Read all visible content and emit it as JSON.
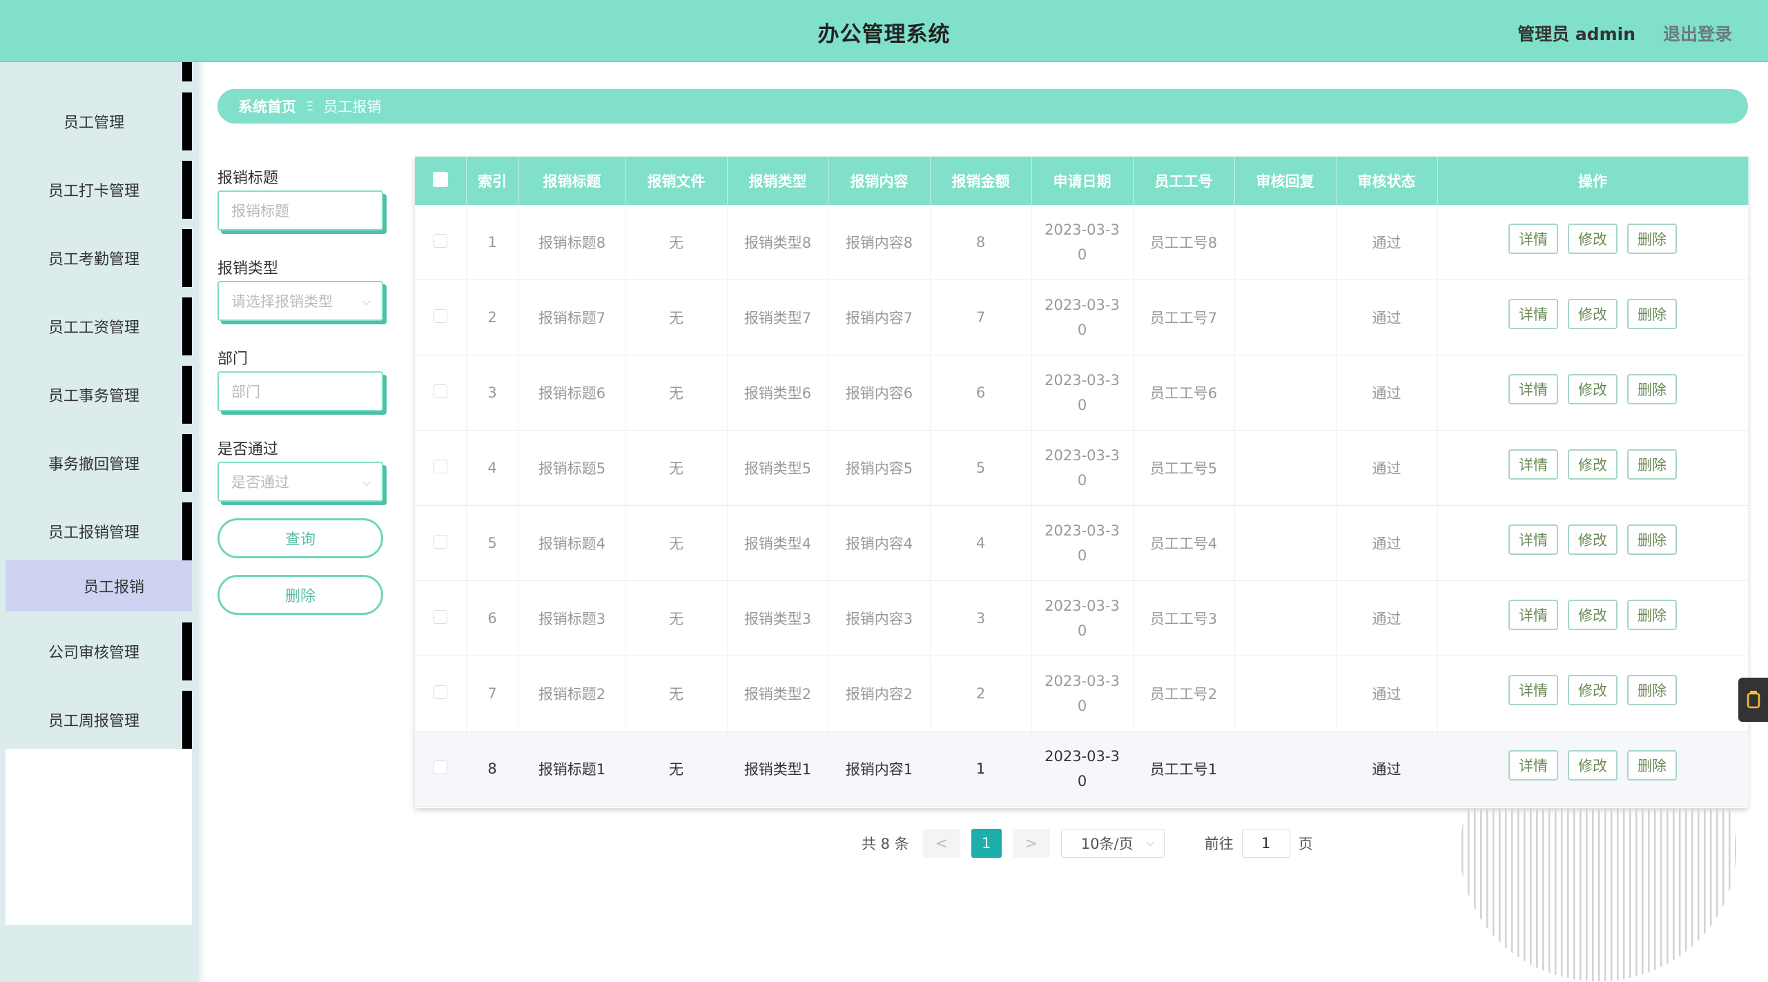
{
  "header": {
    "app_title": "办公管理系统",
    "user_label": "管理员 admin",
    "logout_label": "退出登录"
  },
  "sidebar": {
    "items": [
      {
        "label": "员工管理"
      },
      {
        "label": "员工打卡管理"
      },
      {
        "label": "员工考勤管理"
      },
      {
        "label": "员工工资管理"
      },
      {
        "label": "员工事务管理"
      },
      {
        "label": "事务撤回管理"
      },
      {
        "label": "员工报销管理"
      },
      {
        "label": "公司审核管理"
      },
      {
        "label": "员工周报管理"
      }
    ],
    "active_sub": "员工报销"
  },
  "breadcrumb": {
    "home": "系统首页",
    "separator": "Ξ",
    "current": "员工报销"
  },
  "filter": {
    "title_label": "报销标题",
    "title_placeholder": "报销标题",
    "type_label": "报销类型",
    "type_placeholder": "请选择报销类型",
    "dept_label": "部门",
    "dept_placeholder": "部门",
    "pass_label": "是否通过",
    "pass_placeholder": "是否通过",
    "query_button": "查询",
    "delete_button": "删除"
  },
  "table": {
    "columns": [
      "索引",
      "报销标题",
      "报销文件",
      "报销类型",
      "报销内容",
      "报销金额",
      "申请日期",
      "员工工号",
      "审核回复",
      "审核状态",
      "操作"
    ],
    "rows": [
      {
        "index": "1",
        "title": "报销标题8",
        "file": "无",
        "type": "报销类型8",
        "content": "报销内容8",
        "amount": "8",
        "date_a": "2023-03-3",
        "date_b": "0",
        "emp": "员工工号8",
        "reply": "",
        "status": "通过"
      },
      {
        "index": "2",
        "title": "报销标题7",
        "file": "无",
        "type": "报销类型7",
        "content": "报销内容7",
        "amount": "7",
        "date_a": "2023-03-3",
        "date_b": "0",
        "emp": "员工工号7",
        "reply": "",
        "status": "通过"
      },
      {
        "index": "3",
        "title": "报销标题6",
        "file": "无",
        "type": "报销类型6",
        "content": "报销内容6",
        "amount": "6",
        "date_a": "2023-03-3",
        "date_b": "0",
        "emp": "员工工号6",
        "reply": "",
        "status": "通过"
      },
      {
        "index": "4",
        "title": "报销标题5",
        "file": "无",
        "type": "报销类型5",
        "content": "报销内容5",
        "amount": "5",
        "date_a": "2023-03-3",
        "date_b": "0",
        "emp": "员工工号5",
        "reply": "",
        "status": "通过"
      },
      {
        "index": "5",
        "title": "报销标题4",
        "file": "无",
        "type": "报销类型4",
        "content": "报销内容4",
        "amount": "4",
        "date_a": "2023-03-3",
        "date_b": "0",
        "emp": "员工工号4",
        "reply": "",
        "status": "通过"
      },
      {
        "index": "6",
        "title": "报销标题3",
        "file": "无",
        "type": "报销类型3",
        "content": "报销内容3",
        "amount": "3",
        "date_a": "2023-03-3",
        "date_b": "0",
        "emp": "员工工号3",
        "reply": "",
        "status": "通过"
      },
      {
        "index": "7",
        "title": "报销标题2",
        "file": "无",
        "type": "报销类型2",
        "content": "报销内容2",
        "amount": "2",
        "date_a": "2023-03-3",
        "date_b": "0",
        "emp": "员工工号2",
        "reply": "",
        "status": "通过"
      },
      {
        "index": "8",
        "title": "报销标题1",
        "file": "无",
        "type": "报销类型1",
        "content": "报销内容1",
        "amount": "1",
        "date_a": "2023-03-3",
        "date_b": "0",
        "emp": "员工工号1",
        "reply": "",
        "status": "通过"
      }
    ],
    "actions": {
      "detail": "详情",
      "edit": "修改",
      "delete": "删除"
    }
  },
  "pagination": {
    "total": "共 8 条",
    "prev": "<",
    "current_page": "1",
    "next": ">",
    "page_size": "10条/页",
    "goto_label": "前往",
    "goto_value": "1",
    "page_suffix": "页"
  },
  "colors": {
    "accent": "#80e0c9",
    "active_page": "#1eaeac",
    "sidebar_bg": "#dcebeb",
    "sidebar_active": "#ced3f2"
  }
}
